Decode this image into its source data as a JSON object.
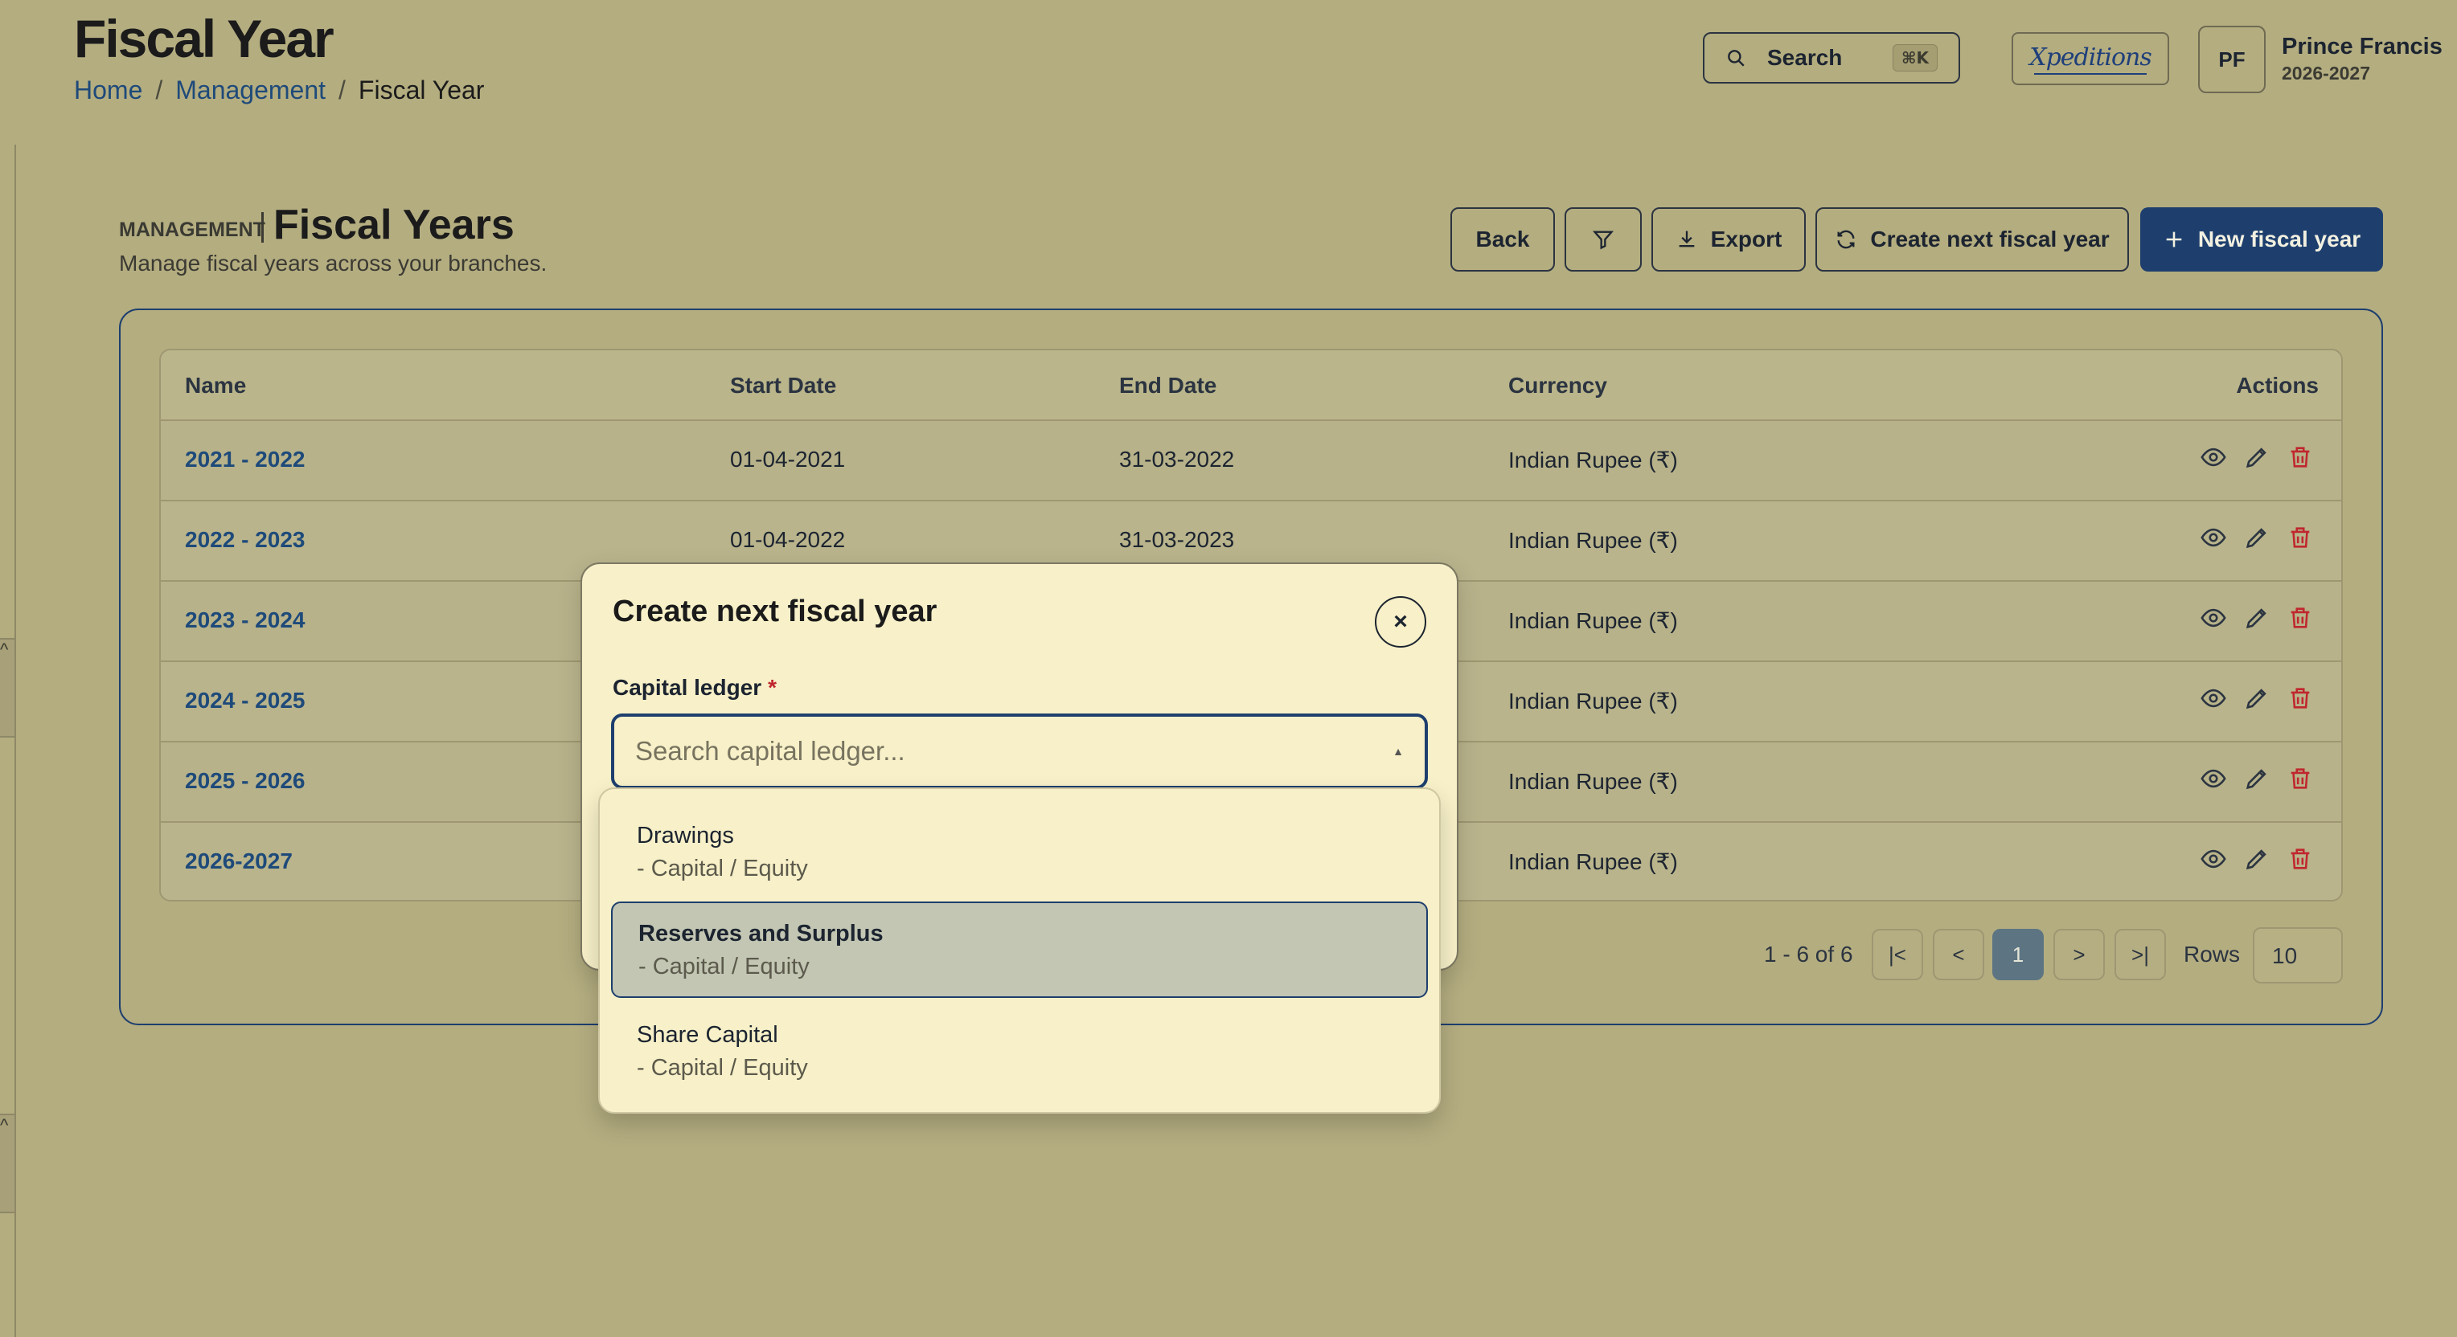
{
  "header": {
    "title": "Fiscal Year",
    "breadcrumb": [
      "Home",
      "Management",
      "Fiscal Year"
    ],
    "search_label": "Search",
    "search_shortcut": "⌘K",
    "logo_text": "Xpeditions",
    "avatar_initials": "PF",
    "user_name": "Prince Francis",
    "user_year": "2026-2027"
  },
  "section": {
    "eyebrow": "MANAGEMENT",
    "title": "Fiscal Years",
    "subtitle": "Manage fiscal years across your branches."
  },
  "toolbar": {
    "back": "Back",
    "export": "Export",
    "create_next": "Create next fiscal year",
    "new_year": "New fiscal year"
  },
  "table": {
    "columns": [
      "Name",
      "Start Date",
      "End Date",
      "Currency",
      "Actions"
    ],
    "rows": [
      {
        "name": "2021 - 2022",
        "start": "01-04-2021",
        "end": "31-03-2022",
        "currency": "Indian Rupee (₹)"
      },
      {
        "name": "2022 - 2023",
        "start": "01-04-2022",
        "end": "31-03-2023",
        "currency": "Indian Rupee (₹)"
      },
      {
        "name": "2023 - 2024",
        "start": "",
        "end": "",
        "currency": "Indian Rupee (₹)"
      },
      {
        "name": "2024 - 2025",
        "start": "",
        "end": "",
        "currency": "Indian Rupee (₹)"
      },
      {
        "name": "2025 - 2026",
        "start": "",
        "end": "",
        "currency": "Indian Rupee (₹)"
      },
      {
        "name": "2026-2027",
        "start": "",
        "end": "",
        "currency": "Indian Rupee (₹)"
      }
    ]
  },
  "pagination": {
    "info": "1 - 6 of 6",
    "first": "|<",
    "prev": "<",
    "current": "1",
    "next": ">",
    "last": ">|",
    "rows_label": "Rows",
    "rows_value": "10"
  },
  "modal": {
    "title": "Create next fiscal year",
    "close": "×",
    "field_label": "Capital ledger",
    "required_mark": "*",
    "placeholder": "Search capital ledger...",
    "options": [
      {
        "title": "Drawings",
        "sub": "- Capital / Equity"
      },
      {
        "title": "Reserves and Surplus",
        "sub": "- Capital / Equity"
      },
      {
        "title": "Share Capital",
        "sub": "- Capital / Equity"
      }
    ]
  },
  "colors": {
    "background": "#b4ad80",
    "primary": "#1e3f6e",
    "link": "#1e4a7a",
    "danger": "#c0262d",
    "modal_bg": "#f7f0c8"
  }
}
